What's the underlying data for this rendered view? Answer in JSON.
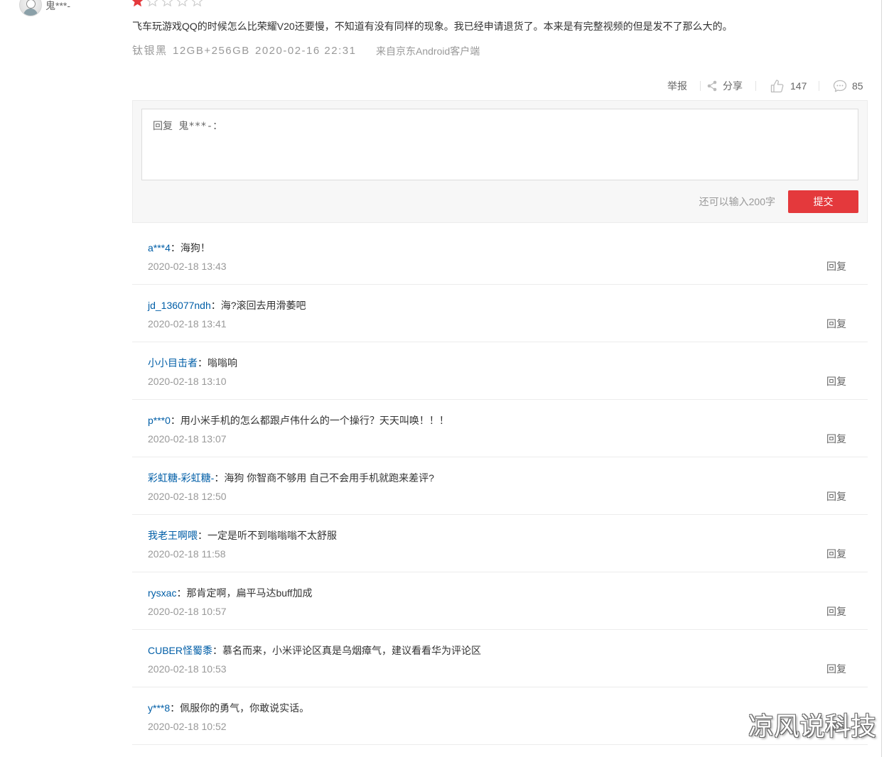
{
  "review": {
    "username": "鬼***-",
    "rating": 1,
    "rating_max": 5,
    "content": "飞车玩游戏QQ的时候怎么比荣耀V20还要慢，不知道有没有同样的现象。我已经申请退货了。本来是有完整视频的但是发不了那么大的。",
    "color_variant": "钛银黑",
    "spec": "12GB+256GB",
    "time": "2020-02-16 22:31",
    "source": "来自京东Android客户端"
  },
  "actions": {
    "report_label": "举报",
    "share_label": "分享",
    "like_count": "147",
    "comment_count": "85"
  },
  "reply_box": {
    "placeholder": "回复 鬼***-：",
    "remaining_hint": "还可以输入200字",
    "submit_label": "提交"
  },
  "separator": "：",
  "reply_label": "回复",
  "replies": [
    {
      "name": "a***4",
      "text": "海狗！",
      "time": "2020-02-18 13:43"
    },
    {
      "name": "jd_136077ndh",
      "text": "海?滚回去用滑萎吧",
      "time": "2020-02-18 13:41"
    },
    {
      "name": "小小目击者",
      "text": "嗡嗡响",
      "time": "2020-02-18 13:10"
    },
    {
      "name": "p***0",
      "text": "用小米手机的怎么都跟卢伟什么的一个操行？天天叫唤！！！",
      "time": "2020-02-18 13:07"
    },
    {
      "name": "彩虹糖-彩虹糖-",
      "text": "海狗 你智商不够用 自己不会用手机就跑来差评?",
      "time": "2020-02-18 12:50"
    },
    {
      "name": "我老王啊喂",
      "text": "一定是听不到嗡嗡嗡不太舒服",
      "time": "2020-02-18 11:58"
    },
    {
      "name": "rysxac",
      "text": "那肯定啊，扁平马达buff加成",
      "time": "2020-02-18 10:57"
    },
    {
      "name": "CUBER怪蜀黍",
      "text": "慕名而来，小米评论区真是乌烟瘴气，建议看看华为评论区",
      "time": "2020-02-18 10:53"
    },
    {
      "name": "y***8",
      "text": "佩服你的勇气，你敢说实话。",
      "time": "2020-02-18 10:52"
    }
  ],
  "watermark": "凉风说科技",
  "icons": {
    "avatar": "user-avatar",
    "star": "star-icon",
    "share": "share-icon",
    "like": "thumbs-up-icon",
    "comment": "comment-bubble-icon"
  },
  "colors": {
    "accent": "#e4393c",
    "username_link": "#005ea7",
    "text": "#333333",
    "muted": "#999999",
    "panel_bg": "#f7f7f7"
  }
}
